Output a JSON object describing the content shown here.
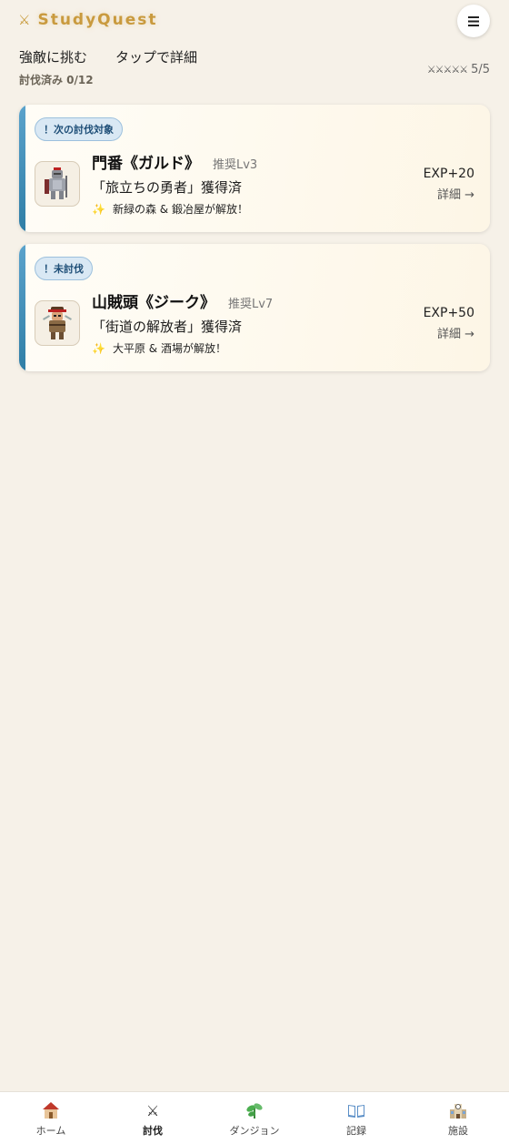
{
  "app": {
    "title": "StudyQuest",
    "logo_icon": "crossed-swords-icon"
  },
  "header": {
    "tab_challenge": "強敵に挑む",
    "tab_detail_hint": "タップで詳細",
    "defeated_count": "討伐済み 0/12",
    "stars_icons": "⚔⚔⚔⚔⚔",
    "stars_value": "5/5"
  },
  "cards": [
    {
      "badge": "！次の討伐対象",
      "name": "門番《ガルド》",
      "level": "推奨Lv3",
      "title": "「旅立ちの勇者」獲得済",
      "unlock": "新緑の森 & 鍛冶屋が解放！",
      "exp": "EXP+20",
      "detail": "詳細 →"
    },
    {
      "badge": "！未討伐",
      "name": "山賊頭《ジーク》",
      "level": "推奨Lv7",
      "title": "「街道の解放者」獲得済",
      "unlock": "大平原 & 酒場が解放！",
      "exp": "EXP+50",
      "detail": "詳細 →"
    }
  ],
  "nav": [
    {
      "label": "ホーム",
      "icon": "house-icon"
    },
    {
      "label": "討伐",
      "icon": "crossed-swords-icon",
      "active": true
    },
    {
      "label": "ダンジョン",
      "icon": "herb-icon"
    },
    {
      "label": "記録",
      "icon": "book-icon"
    },
    {
      "label": "施設",
      "icon": "school-building-icon"
    }
  ],
  "colors": {
    "accent": "#2f7ea6",
    "brand_gold": "#c99a3e",
    "background": "#f6f1e8"
  }
}
